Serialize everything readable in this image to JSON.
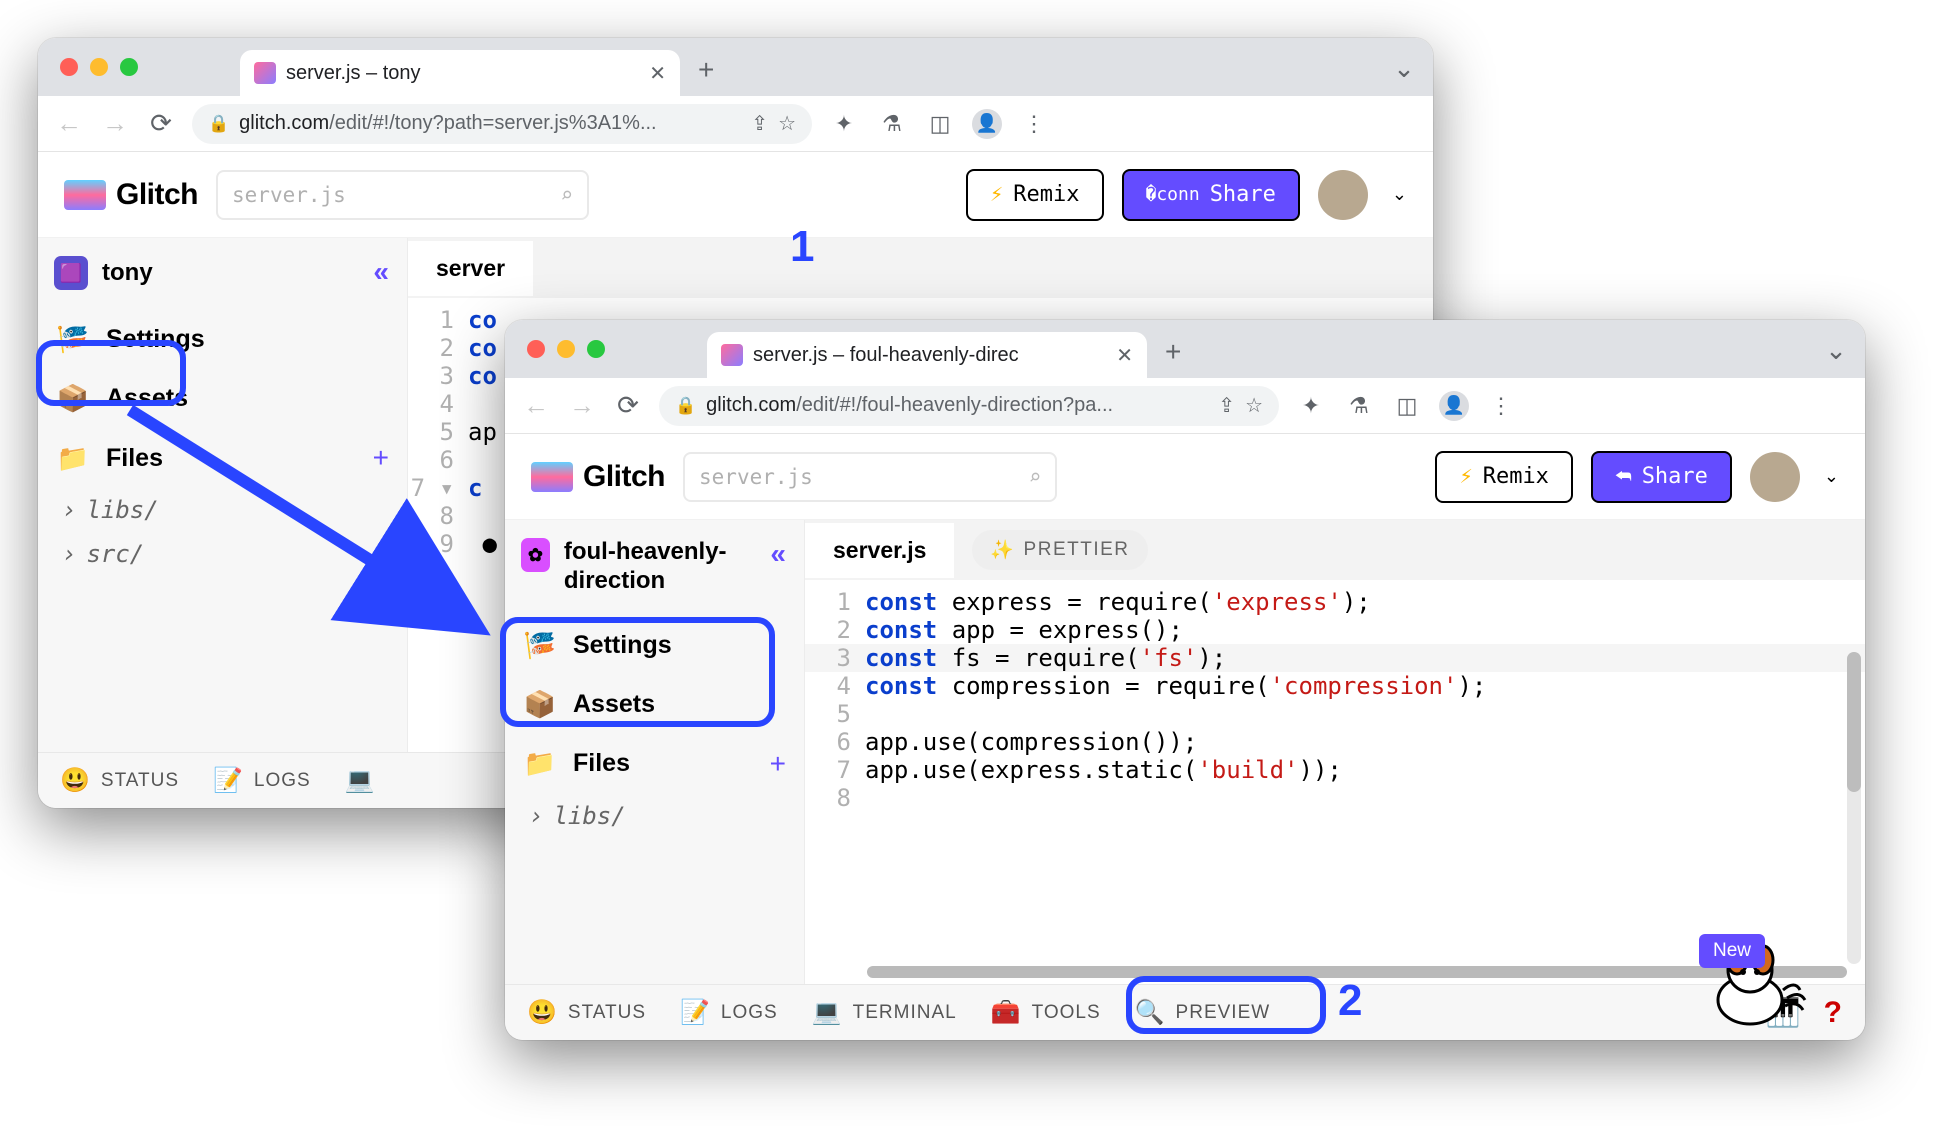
{
  "annotations": {
    "label1": "1",
    "label2": "2"
  },
  "window1": {
    "tab_title": "server.js – tony",
    "url_host": "glitch.com",
    "url_path": "/edit/#!/tony?path=server.js%3A1%...",
    "chevron_down": "⌄",
    "header": {
      "logo_text": "Glitch",
      "search_placeholder": "server.js",
      "remix_label": "Remix",
      "share_label": "Share"
    },
    "sidebar": {
      "project_name": "tony",
      "collapse_glyph": "«",
      "items": [
        {
          "emoji": "🎏",
          "label": "Settings"
        },
        {
          "emoji": "📦",
          "label": "Assets"
        },
        {
          "emoji": "📁",
          "label": "Files",
          "plus": "+"
        }
      ],
      "folders": [
        "libs/",
        "src/"
      ]
    },
    "editor": {
      "filename": "server",
      "lines": [
        {
          "n": 1,
          "content": [
            {
              "t": "kw",
              "s": "co"
            }
          ]
        },
        {
          "n": 2,
          "content": [
            {
              "t": "kw",
              "s": "co"
            }
          ]
        },
        {
          "n": 3,
          "content": [
            {
              "t": "kw",
              "s": "co"
            }
          ]
        },
        {
          "n": 4,
          "content": [
            {
              "t": "plain",
              "s": ""
            }
          ]
        },
        {
          "n": 5,
          "content": [
            {
              "t": "plain",
              "s": "ap"
            }
          ]
        },
        {
          "n": 6,
          "content": [
            {
              "t": "plain",
              "s": ""
            }
          ]
        },
        {
          "n": 7,
          "content": [
            {
              "t": "kw",
              "s": "c"
            }
          ],
          "fold": true
        },
        {
          "n": 8,
          "content": [
            {
              "t": "plain",
              "s": ""
            }
          ]
        },
        {
          "n": 9,
          "content": [
            {
              "t": "plain",
              "s": ""
            }
          ],
          "dot": true
        }
      ]
    },
    "footer": [
      {
        "emoji": "😃",
        "label": "STATUS"
      },
      {
        "emoji": "📝",
        "label": "LOGS"
      },
      {
        "emoji": "💻",
        "label": ""
      }
    ]
  },
  "window2": {
    "tab_title": "server.js – foul-heavenly-direc",
    "url_host": "glitch.com",
    "url_path": "/edit/#!/foul-heavenly-direction?pa...",
    "chevron_down": "⌄",
    "header": {
      "logo_text": "Glitch",
      "search_placeholder": "server.js",
      "remix_label": "Remix",
      "share_label": "Share"
    },
    "sidebar": {
      "project_name": "foul-heavenly-direction",
      "collapse_glyph": "«",
      "items": [
        {
          "emoji": "🎏",
          "label": "Settings"
        },
        {
          "emoji": "📦",
          "label": "Assets"
        },
        {
          "emoji": "📁",
          "label": "Files",
          "plus": "+"
        }
      ],
      "folders": [
        "libs/"
      ]
    },
    "editor": {
      "filename": "server.js",
      "prettier_label": "PRETTIER",
      "lines": [
        {
          "n": 1,
          "content": [
            {
              "t": "kw",
              "s": "const"
            },
            {
              "t": "plain",
              "s": " express = require("
            },
            {
              "t": "str",
              "s": "'express'"
            },
            {
              "t": "plain",
              "s": ");"
            }
          ]
        },
        {
          "n": 2,
          "content": [
            {
              "t": "kw",
              "s": "const"
            },
            {
              "t": "plain",
              "s": " app = express();"
            }
          ]
        },
        {
          "n": 3,
          "hl": true,
          "content": [
            {
              "t": "kw",
              "s": "const"
            },
            {
              "t": "plain",
              "s": " fs = require("
            },
            {
              "t": "str",
              "s": "'fs'"
            },
            {
              "t": "plain",
              "s": ");"
            }
          ]
        },
        {
          "n": 4,
          "content": [
            {
              "t": "kw",
              "s": "const"
            },
            {
              "t": "plain",
              "s": " compression = require("
            },
            {
              "t": "str",
              "s": "'compression'"
            },
            {
              "t": "plain",
              "s": ");"
            }
          ]
        },
        {
          "n": 5,
          "content": [
            {
              "t": "plain",
              "s": ""
            }
          ]
        },
        {
          "n": 6,
          "content": [
            {
              "t": "plain",
              "s": "app.use(compression());"
            }
          ]
        },
        {
          "n": 7,
          "content": [
            {
              "t": "plain",
              "s": "app.use(express.static("
            },
            {
              "t": "str",
              "s": "'build'"
            },
            {
              "t": "plain",
              "s": "));"
            }
          ]
        },
        {
          "n": 8,
          "content": [
            {
              "t": "plain",
              "s": ""
            }
          ]
        }
      ]
    },
    "footer": [
      {
        "emoji": "😃",
        "label": "STATUS"
      },
      {
        "emoji": "📝",
        "label": "LOGS"
      },
      {
        "emoji": "💻",
        "label": "TERMINAL"
      },
      {
        "emoji": "🧰",
        "label": "TOOLS"
      },
      {
        "emoji": "🔍",
        "label": "PREVIEW"
      }
    ],
    "new_badge": "New",
    "question": "?",
    "piano": "𝄞"
  }
}
